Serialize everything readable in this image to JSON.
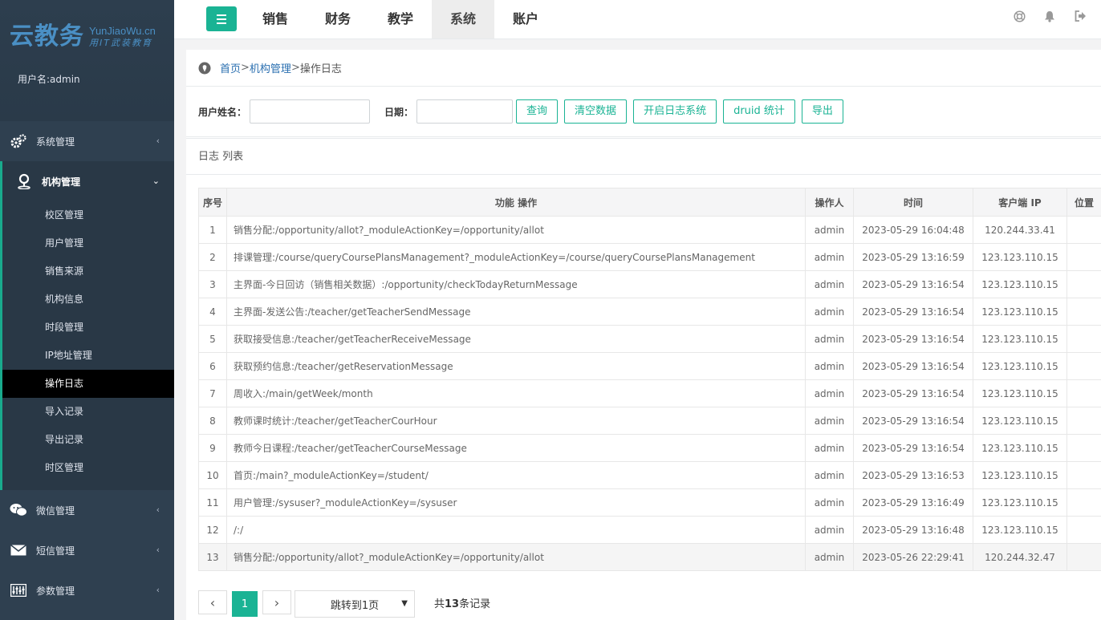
{
  "brand": {
    "logo": "云教务",
    "domain": "YunJiaoWu.cn",
    "slogan": "用IT武装教育"
  },
  "user": {
    "label": "用户名:admin"
  },
  "sidebar": {
    "items": [
      {
        "label": "系统管理",
        "icon": "gears-icon"
      },
      {
        "label": "机构管理",
        "icon": "map-pin-icon"
      },
      {
        "label": "微信管理",
        "icon": "wechat-icon"
      },
      {
        "label": "短信管理",
        "icon": "envelope-icon"
      },
      {
        "label": "参数管理",
        "icon": "sliders-icon"
      }
    ],
    "submenu": [
      "校区管理",
      "用户管理",
      "销售来源",
      "机构信息",
      "时段管理",
      "IP地址管理",
      "操作日志",
      "导入记录",
      "导出记录",
      "时区管理"
    ]
  },
  "topbar": {
    "tabs": [
      "销售",
      "财务",
      "教学",
      "系统",
      "账户"
    ],
    "active_tab": "系统",
    "icons": [
      "globe-icon",
      "bell-icon",
      "logout-icon"
    ]
  },
  "breadcrumb": {
    "home": "首页",
    "sep1": " >",
    "org": "机构管理",
    "sep2": " >",
    "current": "操作日志"
  },
  "filter": {
    "username_label": "用户姓名：",
    "username_value": "",
    "date_label": "日期：",
    "date_value": "",
    "buttons": [
      "查询",
      "清空数据",
      "开启日志系统",
      "druid 统计",
      "导出"
    ]
  },
  "list_title": "日志 列表",
  "table": {
    "headers": [
      "序号",
      "功能 操作",
      "操作人",
      "时间",
      "客户端 IP",
      "位置"
    ],
    "rows": [
      [
        "1",
        "销售分配:/opportunity/allot?_moduleActionKey=/opportunity/allot",
        "admin",
        "2023-05-29 16:04:48",
        "120.244.33.41",
        ""
      ],
      [
        "2",
        "排课管理:/course/queryCoursePlansManagement?_moduleActionKey=/course/queryCoursePlansManagement",
        "admin",
        "2023-05-29 13:16:59",
        "123.123.110.15",
        ""
      ],
      [
        "3",
        "主界面-今日回访（销售相关数据）:/opportunity/checkTodayReturnMessage",
        "admin",
        "2023-05-29 13:16:54",
        "123.123.110.15",
        ""
      ],
      [
        "4",
        "主界面-发送公告:/teacher/getTeacherSendMessage",
        "admin",
        "2023-05-29 13:16:54",
        "123.123.110.15",
        ""
      ],
      [
        "5",
        "获取接受信息:/teacher/getTeacherReceiveMessage",
        "admin",
        "2023-05-29 13:16:54",
        "123.123.110.15",
        ""
      ],
      [
        "6",
        "获取预约信息:/teacher/getReservationMessage",
        "admin",
        "2023-05-29 13:16:54",
        "123.123.110.15",
        ""
      ],
      [
        "7",
        "周收入:/main/getWeek/month",
        "admin",
        "2023-05-29 13:16:54",
        "123.123.110.15",
        ""
      ],
      [
        "8",
        "教师课时统计:/teacher/getTeacherCourHour",
        "admin",
        "2023-05-29 13:16:54",
        "123.123.110.15",
        ""
      ],
      [
        "9",
        "教师今日课程:/teacher/getTeacherCourseMessage",
        "admin",
        "2023-05-29 13:16:54",
        "123.123.110.15",
        ""
      ],
      [
        "10",
        "首页:/main?_moduleActionKey=/student/",
        "admin",
        "2023-05-29 13:16:53",
        "123.123.110.15",
        ""
      ],
      [
        "11",
        "用户管理:/sysuser?_moduleActionKey=/sysuser",
        "admin",
        "2023-05-29 13:16:49",
        "123.123.110.15",
        ""
      ],
      [
        "12",
        "/:/",
        "admin",
        "2023-05-29 13:16:48",
        "123.123.110.15",
        ""
      ],
      [
        "13",
        "销售分配:/opportunity/allot?_moduleActionKey=/opportunity/allot",
        "admin",
        "2023-05-26 22:29:41",
        "120.244.32.47",
        ""
      ]
    ]
  },
  "pager": {
    "prev": "‹",
    "page": "1",
    "next": "›",
    "jump": "跳转到1页",
    "total_prefix": "共",
    "total_count": "13",
    "total_suffix": "条记录"
  },
  "colors": {
    "accent": "#1ab394",
    "sidebar": "#2f4050",
    "link": "#2a6fb0"
  }
}
